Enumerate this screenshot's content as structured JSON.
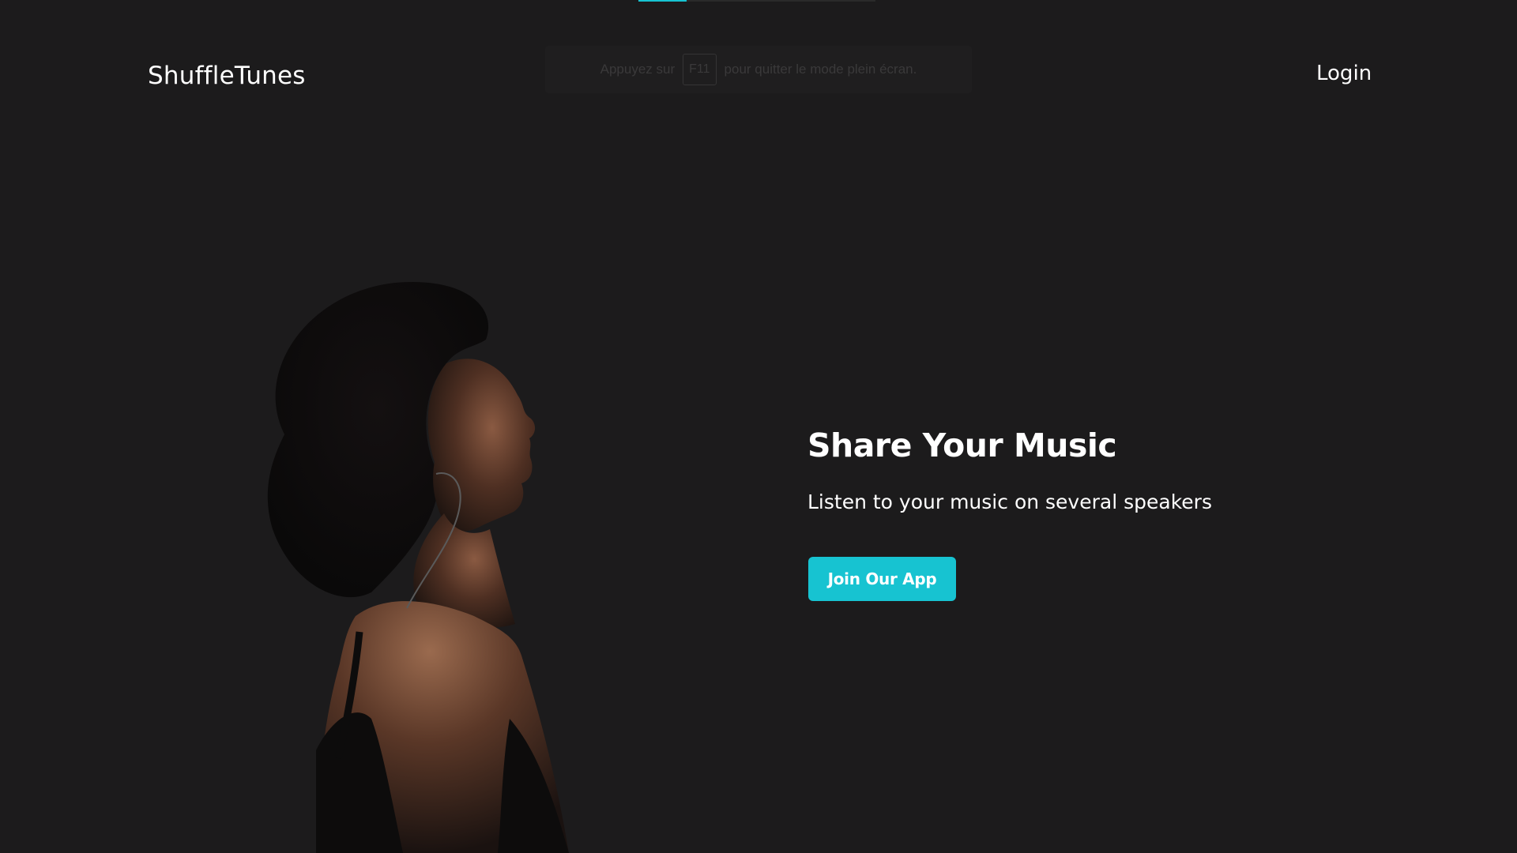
{
  "browser": {
    "fullscreen_notice_prefix": "Appuyez sur",
    "fullscreen_notice_key": "F11",
    "fullscreen_notice_suffix": "pour quitter le mode plein écran."
  },
  "header": {
    "logo": "ShuffleTunes",
    "login_label": "Login"
  },
  "hero": {
    "title": "Share Your Music",
    "subtitle": "Listen to your music on several speakers",
    "cta_label": "Join Our App",
    "image_alt": "woman-listening-with-headphones"
  },
  "colors": {
    "background": "#1c1b1c",
    "accent": "#17c3d1",
    "text": "#ffffff"
  }
}
